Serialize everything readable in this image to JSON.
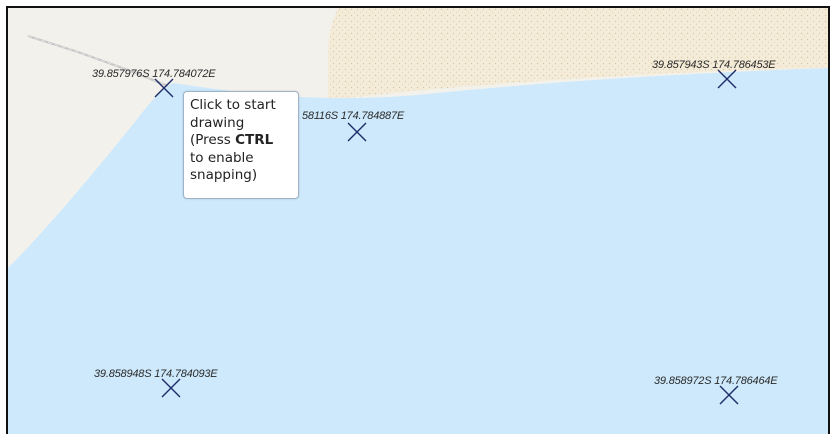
{
  "map": {
    "colors": {
      "water": "#cde9fb",
      "land": "#f3f1ec",
      "sand": "#f5edd9",
      "road": "#bfbfbf",
      "marker": "#1f2d6b"
    },
    "points": [
      {
        "lat": "39.857976S",
        "lon": "174.784072E",
        "label": "39.857976S 174.784072E"
      },
      {
        "lat": "39.858116S",
        "lon": "174.784887E",
        "label": "58116S 174.784887E"
      },
      {
        "lat": "39.857943S",
        "lon": "174.786453E",
        "label": "39.857943S 174.786453E"
      },
      {
        "lat": "39.858948S",
        "lon": "174.784093E",
        "label": "39.858948S 174.784093E"
      },
      {
        "lat": "39.858972S",
        "lon": "174.786464E",
        "label": "39.858972S 174.786464E"
      }
    ]
  },
  "tooltip": {
    "line1": "Click to start",
    "line2": "drawing",
    "line3_prefix": "(Press ",
    "line3_key": "CTRL",
    "line4": "to enable",
    "line5": "snapping)"
  }
}
